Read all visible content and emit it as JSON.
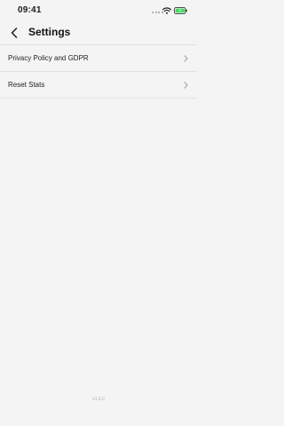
{
  "status_bar": {
    "time": "09:41"
  },
  "header": {
    "title": "Settings"
  },
  "settings": {
    "items": [
      {
        "label": "Privacy Policy and GDPR"
      },
      {
        "label": "Reset Stats"
      }
    ]
  },
  "footer": {
    "version": "v1.0.0"
  },
  "colors": {
    "background": "#f4f4f4",
    "divider": "#e2e2e2",
    "battery_fill": "#4cd964",
    "chevron": "#9a9a9a"
  },
  "icons": [
    "wifi-icon",
    "battery-icon",
    "back-arrow-icon",
    "chevron-right-icon"
  ]
}
